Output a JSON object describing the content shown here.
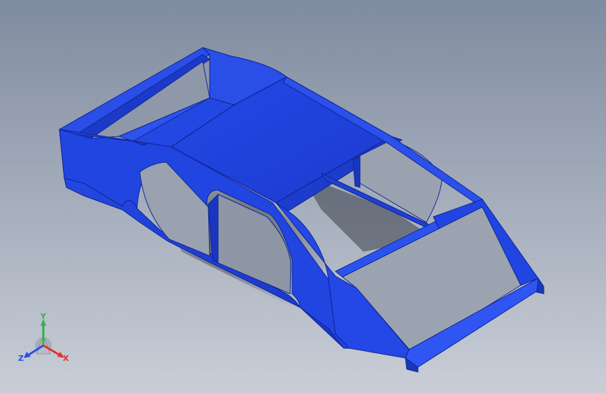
{
  "viewport": {
    "background_top": "#7f8b9f",
    "background_bottom": "#c8cdd6"
  },
  "model": {
    "name": "car-body-shell",
    "body_color": "#1f3fd8",
    "highlight_color": "#3a5cf0",
    "shadow_color": "#1230a8"
  },
  "triad": {
    "x_label": "X",
    "y_label": "Y",
    "z_label": "Z",
    "x_color": "#e23030",
    "y_color": "#2fb24a",
    "z_color": "#2a4fe0"
  }
}
